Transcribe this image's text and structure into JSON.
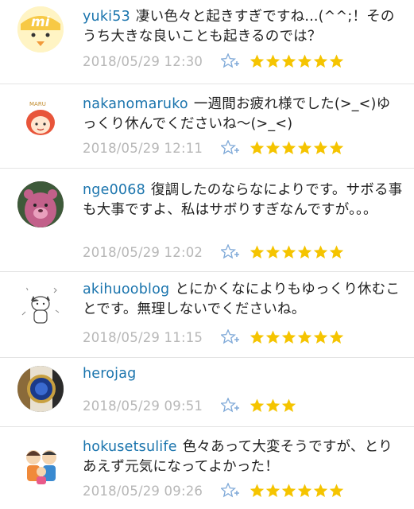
{
  "comments": [
    {
      "username": "yuki53",
      "text": "凄い色々と起きすぎですね...(^^;！そのうち大きな良いことも起きるのでは？",
      "date": "2018/05/29 12:30",
      "stars": 6
    },
    {
      "username": "nakanomaruko",
      "text": "一週間お疲れ様でした(>_<)ゆっくり休んでくださいね〜(>_<)",
      "date": "2018/05/29 12:11",
      "stars": 6
    },
    {
      "username": "nge0068",
      "text": "復調したのならなによりです。サボる事も大事ですよ、私はサボりすぎなんですが。。。",
      "date": "2018/05/29 12:02",
      "stars": 6
    },
    {
      "username": "akihuooblog",
      "text": "とにかくなによりもゆっくり休むことです。無理しないでくださいね。",
      "date": "2018/05/29 11:15",
      "stars": 6
    },
    {
      "username": "herojag",
      "text": "",
      "date": "2018/05/29 09:51",
      "stars": 3
    },
    {
      "username": "hokusetsulife",
      "text": "色々あって大変そうですが、とりあえず元気になってよかった！",
      "date": "2018/05/29 09:26",
      "stars": 6
    }
  ],
  "colors": {
    "username": "#1a74ad",
    "star": "#f5c400",
    "add_star": "#7fa9d8",
    "date": "#b7b7b7"
  }
}
